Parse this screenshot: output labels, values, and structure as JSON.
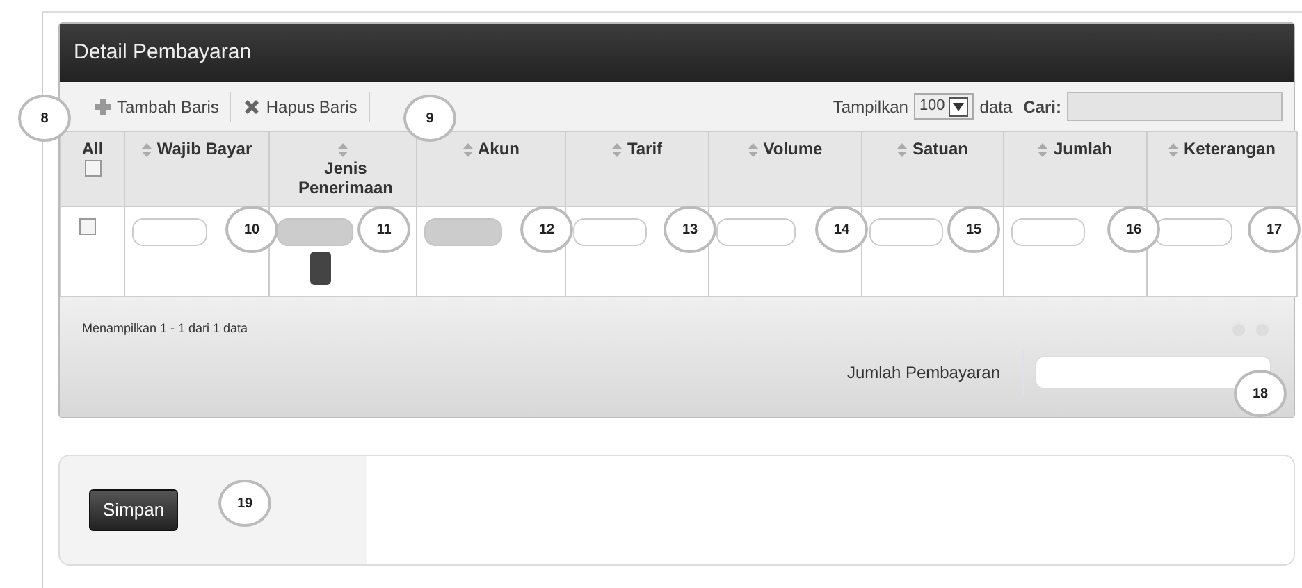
{
  "panel": {
    "title": "Detail Pembayaran"
  },
  "toolbar": {
    "buttons": [
      {
        "label": "Tambah Baris",
        "kind": "add"
      },
      {
        "label": "Hapus Baris",
        "kind": "delete"
      }
    ],
    "length_label": "Tampilkan",
    "length_value": "100",
    "length_suffix": "data",
    "search_label": "Cari:"
  },
  "table": {
    "select_all": {
      "label": "All",
      "checked": false
    },
    "columns": [
      {
        "label": "Wajib Bayar"
      },
      {
        "label": "Jenis Penerimaan"
      },
      {
        "label": "Akun"
      },
      {
        "label": "Tarif"
      },
      {
        "label": "Volume"
      },
      {
        "label": "Satuan"
      },
      {
        "label": "Jumlah"
      },
      {
        "label": "Keterangan"
      }
    ],
    "rows": [
      {
        "checked": false,
        "fields": [
          {
            "disabled": false
          },
          {
            "disabled": true,
            "kind": "lookup"
          },
          {
            "disabled": true
          },
          {
            "disabled": false
          },
          {
            "disabled": false
          },
          {
            "disabled": false
          },
          {
            "disabled": false
          },
          {
            "disabled": false
          }
        ]
      }
    ]
  },
  "footer": {
    "info": "Menampilkan 1 - 1 dari 1 data",
    "total_label": "Jumlah Pembayaran"
  },
  "save_button": "Simpan",
  "callouts": [
    {
      "label": "8"
    },
    {
      "label": "9"
    },
    {
      "label": "10"
    },
    {
      "label": "11"
    },
    {
      "label": "12"
    },
    {
      "label": "13"
    },
    {
      "label": "14"
    },
    {
      "label": "15"
    },
    {
      "label": "16"
    },
    {
      "label": "17"
    },
    {
      "label": "18"
    },
    {
      "label": "19"
    }
  ]
}
